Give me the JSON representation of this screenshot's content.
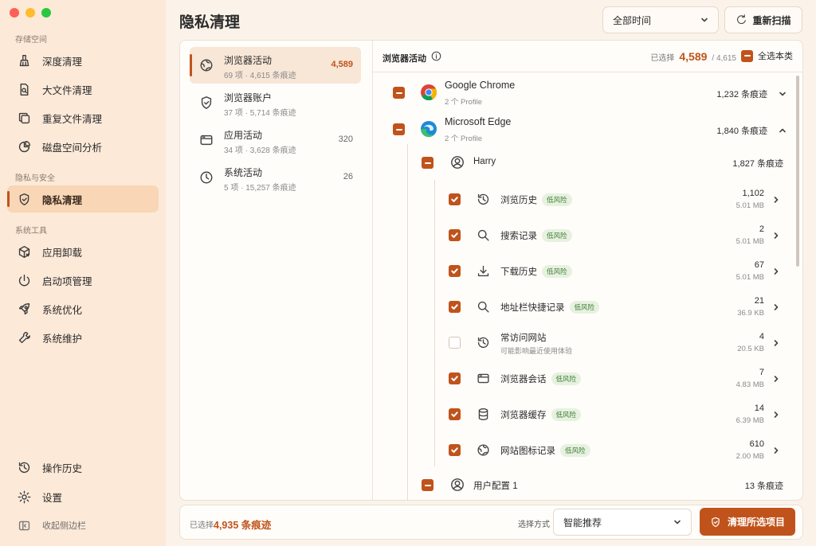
{
  "window": {
    "traffic_lights": [
      "close",
      "minimize",
      "zoom"
    ]
  },
  "sidebar": {
    "sections": [
      {
        "label": "存储空间",
        "items": [
          {
            "label": "深度清理",
            "icon": "broom-icon"
          },
          {
            "label": "大文件清理",
            "icon": "large-file-icon"
          },
          {
            "label": "重复文件清理",
            "icon": "duplicate-icon"
          },
          {
            "label": "磁盘空间分析",
            "icon": "pie-chart-icon"
          }
        ]
      },
      {
        "label": "隐私与安全",
        "items": [
          {
            "label": "隐私清理",
            "icon": "shield-icon",
            "active": true
          }
        ]
      },
      {
        "label": "系统工具",
        "items": [
          {
            "label": "应用卸载",
            "icon": "uninstall-icon"
          },
          {
            "label": "启动项管理",
            "icon": "power-icon"
          },
          {
            "label": "系统优化",
            "icon": "rocket-icon"
          },
          {
            "label": "系统维护",
            "icon": "wrench-icon"
          }
        ]
      }
    ],
    "bottom": {
      "history": "操作历史",
      "settings": "设置",
      "collapse": "收起侧边栏"
    }
  },
  "header": {
    "title": "隐私清理",
    "time_filter": "全部时间",
    "rescan": "重新扫描"
  },
  "categories": [
    {
      "title": "浏览器活动",
      "sub": "69 项 · 4,615 条痕迹",
      "count": "4,589",
      "active": true,
      "icon": "compass-icon"
    },
    {
      "title": "浏览器账户",
      "sub": "37 项 · 5,714 条痕迹",
      "count": "",
      "icon": "shield-check-icon"
    },
    {
      "title": "应用活动",
      "sub": "34 项 · 3,628 条痕迹",
      "count": "320",
      "icon": "window-icon"
    },
    {
      "title": "系统活动",
      "sub": "5 项 · 15,257 条痕迹",
      "count": "26",
      "icon": "clock-icon"
    }
  ],
  "detail": {
    "title": "浏览器活动",
    "selected_label": "已选择",
    "selected_value": "4,589",
    "total": "/ 4,615",
    "select_all": "全选本类",
    "browsers": [
      {
        "name": "Google Chrome",
        "sub": "2 个 Profile",
        "count": "1,232 条痕迹",
        "expanded": false
      },
      {
        "name": "Microsoft Edge",
        "sub": "2 个 Profile",
        "count": "1,840 条痕迹",
        "expanded": true
      }
    ],
    "profile": {
      "name": "Harry",
      "count": "1,827 条痕迹"
    },
    "items": [
      {
        "name": "浏览历史",
        "risk": "低风险",
        "count": "1,102",
        "size": "5.01 MB",
        "checked": true,
        "icon": "history-icon"
      },
      {
        "name": "搜索记录",
        "risk": "低风险",
        "count": "2",
        "size": "5.01 MB",
        "checked": true,
        "icon": "search-icon"
      },
      {
        "name": "下载历史",
        "risk": "低风险",
        "count": "67",
        "size": "5.01 MB",
        "checked": true,
        "icon": "download-icon"
      },
      {
        "name": "地址栏快捷记录",
        "risk": "低风险",
        "count": "21",
        "size": "36.9 KB",
        "checked": true,
        "icon": "search-icon"
      },
      {
        "name": "常访问网站",
        "note": "可能影响最近使用体验",
        "count": "4",
        "size": "20.5 KB",
        "checked": false,
        "icon": "history-icon"
      },
      {
        "name": "浏览器会话",
        "risk": "低风险",
        "count": "7",
        "size": "4.83 MB",
        "checked": true,
        "icon": "window-icon"
      },
      {
        "name": "浏览器缓存",
        "risk": "低风险",
        "count": "14",
        "size": "6.39 MB",
        "checked": true,
        "icon": "database-icon"
      },
      {
        "name": "网站图标记录",
        "risk": "低风险",
        "count": "610",
        "size": "2.00 MB",
        "checked": true,
        "icon": "compass-icon"
      }
    ],
    "profile2": {
      "name": "用户配置 1",
      "count": "13 条痕迹"
    }
  },
  "footer": {
    "selected_label": "已选择",
    "selected_value": "4,935 条痕迹",
    "mode_label": "选择方式",
    "mode_value": "智能推荐",
    "clean_button": "清理所选项目"
  },
  "colors": {
    "accent": "#c0531b",
    "sidebar_bg": "#fce9d8",
    "risk_bg": "#e6f2df"
  }
}
